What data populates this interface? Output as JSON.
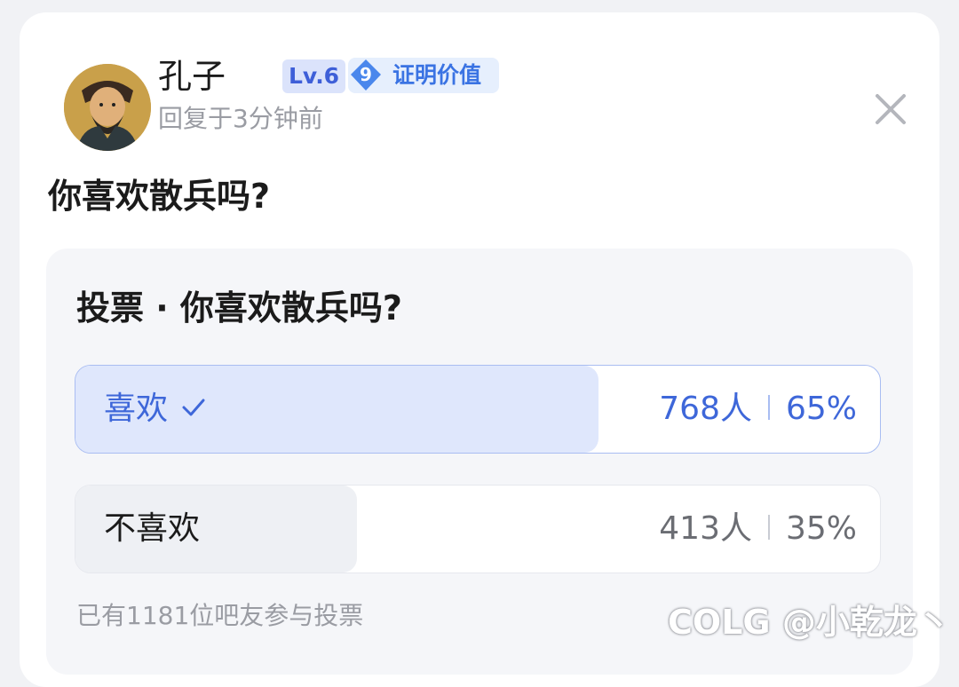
{
  "post": {
    "author": {
      "name": "孔子",
      "level": "Lv.6",
      "value_badge_number": "9",
      "value_badge_label": "证明价值",
      "reply_time": "回复于3分钟前"
    },
    "title": "你喜欢散兵吗?"
  },
  "poll": {
    "title": "投票 · 你喜欢散兵吗?",
    "options": [
      {
        "label": "喜欢",
        "count": "768人",
        "percent": "65%",
        "fraction": 0.65,
        "selected": true
      },
      {
        "label": "不喜欢",
        "count": "413人",
        "percent": "35%",
        "fraction": 0.35,
        "selected": false
      }
    ],
    "footer": "已有1181位吧友参与投票"
  },
  "watermark": "COLG @小乾龙丶",
  "icons": {
    "close": "close-icon",
    "check": "checkmark-icon",
    "diamond": "diamond-icon",
    "avatar": "avatar"
  },
  "colors": {
    "accent": "#3e67d9",
    "selected_fill": "#dfe7fc",
    "unselected_fill": "#eef0f4"
  }
}
